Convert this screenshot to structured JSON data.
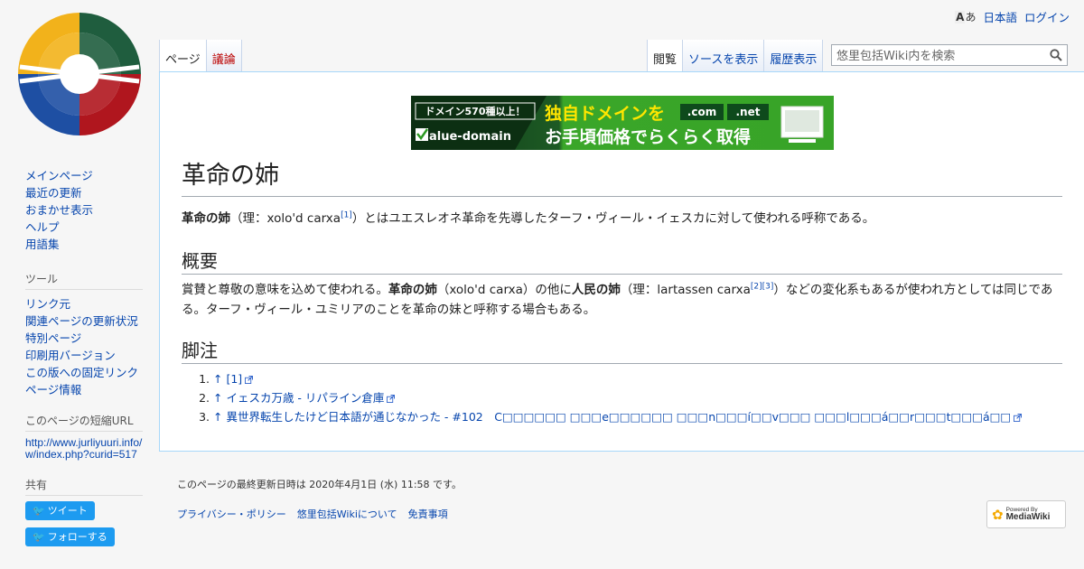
{
  "personal": {
    "lang_icon": "あ",
    "lang_icon_letter": "A",
    "language": "日本語",
    "login": "ログイン"
  },
  "tabs": {
    "page": "ページ",
    "talk": "議論",
    "read": "閲覧",
    "view_source": "ソースを表示",
    "history": "履歴表示"
  },
  "search": {
    "placeholder": "悠里包括Wiki内を検索"
  },
  "sidebar": {
    "nav": [
      "メインページ",
      "最近の更新",
      "おまかせ表示",
      "ヘルプ",
      "用語集"
    ],
    "tools_heading": "ツール",
    "tools": [
      "リンク元",
      "関連ページの更新状況",
      "特別ページ",
      "印刷用バージョン",
      "この版への固定リンク",
      "ページ情報"
    ],
    "short_url_heading": "このページの短縮URL",
    "short_url": "http://www.jurliyuuri.info/w/index.php?curid=517",
    "share_heading": "共有",
    "tweet": "ツイート",
    "follow": "フォローする"
  },
  "banner": {
    "line1": "ドメイン570種以上！",
    "brand": "alue-domain",
    "title1": "独自ドメインを",
    "title2": "お手頃価格でらくらく取得",
    "tld1": ".com",
    "tld2": ".net"
  },
  "article": {
    "title": "革命の姉",
    "intro": {
      "bold": "革命の姉",
      "pre": "（理：xolo'd carxa",
      "ref": "[1]",
      "post": "）とはユエスレオネ革命を先導したターフ・ヴィール・イェスカに対して使われる呼称である。"
    },
    "section1": {
      "heading": "概要",
      "t1": "賞賛と尊敬の意味を込めて使われる。",
      "b1": "革命の姉",
      "t2": "（xolo'd carxa）の他に",
      "b2": "人民の姉",
      "t3": "（理：lartassen carxa",
      "ref2": "[2]",
      "ref3": "[3]",
      "t4": "）などの変化系もあるが使われ方としては同じである。ターフ・ヴィール・ユミリアのことを革命の妹と呼称する場合もある。"
    },
    "section2": {
      "heading": "脚注",
      "refs": [
        "↑ [1]",
        "↑ イェスカ万歳 - リパライン倉庫",
        "↑ 異世界転生したけど日本語が通じなかった - #102　C□□□□□□ □□□e□□□□□□ □□□n□□□í□□v□□□ □□□l□□□á□□r□□□t□□□á□□"
      ]
    }
  },
  "footer": {
    "last_modified": "このページの最終更新日時は 2020年4月1日 (水) 11:58 です。",
    "links": [
      "プライバシー・ポリシー",
      "悠里包括Wikiについて",
      "免責事項"
    ],
    "badge_top": "Powered By",
    "badge_name": "MediaWiki"
  }
}
